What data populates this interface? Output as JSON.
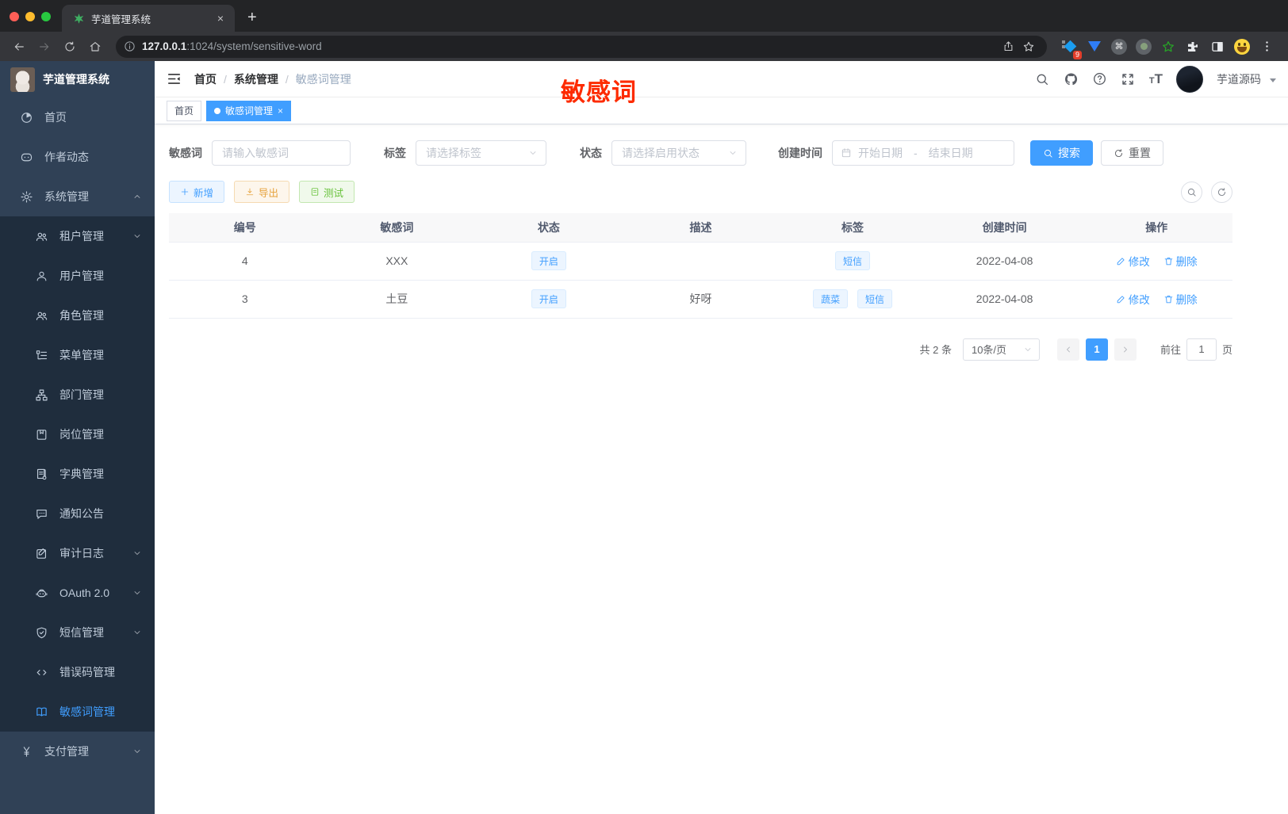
{
  "browser": {
    "tab_title": "芋道管理系统",
    "new_tab": "+",
    "close_tab": "×",
    "url": {
      "host": "127.0.0.1",
      "rest": ":1024/system/sensitive-word"
    },
    "extension_badge": "9",
    "cmd_glyph": "⌘"
  },
  "annotation": {
    "text": "敏感词",
    "color": "#fd2b01"
  },
  "sidebar": {
    "title": "芋道管理系统",
    "items": [
      {
        "icon": "dashboard-icon",
        "label": "首页"
      },
      {
        "icon": "chat-icon",
        "label": "作者动态"
      },
      {
        "icon": "gear-icon",
        "label": "系统管理",
        "expanded": true
      },
      {
        "icon": "tenant-icon",
        "label": "租户管理",
        "sub": true,
        "collapsible": true
      },
      {
        "icon": "user-icon",
        "label": "用户管理",
        "sub": true
      },
      {
        "icon": "role-icon",
        "label": "角色管理",
        "sub": true
      },
      {
        "icon": "menu-tree-icon",
        "label": "菜单管理",
        "sub": true
      },
      {
        "icon": "dept-icon",
        "label": "部门管理",
        "sub": true
      },
      {
        "icon": "post-icon",
        "label": "岗位管理",
        "sub": true
      },
      {
        "icon": "dict-icon",
        "label": "字典管理",
        "sub": true
      },
      {
        "icon": "notice-icon",
        "label": "通知公告",
        "sub": true
      },
      {
        "icon": "audit-icon",
        "label": "审计日志",
        "sub": true,
        "collapsible": true
      },
      {
        "icon": "oauth-icon",
        "label": "OAuth 2.0",
        "sub": true,
        "collapsible": true
      },
      {
        "icon": "sms-icon",
        "label": "短信管理",
        "sub": true,
        "collapsible": true
      },
      {
        "icon": "errcode-icon",
        "label": "错误码管理",
        "sub": true
      },
      {
        "icon": "sensitive-word-icon",
        "label": "敏感词管理",
        "sub": true,
        "active": true
      },
      {
        "icon": "pay-icon",
        "label": "支付管理",
        "collapsible": true
      }
    ]
  },
  "navbar": {
    "breadcrumb": [
      "首页",
      "系统管理",
      "敏感词管理"
    ],
    "separator": "/",
    "user": "芋道源码"
  },
  "tags_view": {
    "home": "首页",
    "active": "敏感词管理",
    "close": "×"
  },
  "filters": {
    "word": {
      "label": "敏感词",
      "placeholder": "请输入敏感词"
    },
    "tag": {
      "label": "标签",
      "placeholder": "请选择标签"
    },
    "status": {
      "label": "状态",
      "placeholder": "请选择启用状态"
    },
    "date": {
      "label": "创建时间",
      "start": "开始日期",
      "separator": "-",
      "end": "结束日期"
    },
    "search": "搜索",
    "reset": "重置"
  },
  "toolbar": {
    "add": "新增",
    "export": "导出",
    "test": "测试"
  },
  "table": {
    "columns": [
      "编号",
      "敏感词",
      "状态",
      "描述",
      "标签",
      "创建时间",
      "操作"
    ],
    "rows": [
      {
        "id": "4",
        "word": "XXX",
        "status": "开启",
        "desc": "",
        "tags": [
          "短信"
        ],
        "created": "2022-04-08"
      },
      {
        "id": "3",
        "word": "土豆",
        "status": "开启",
        "desc": "好呀",
        "tags": [
          "蔬菜",
          "短信"
        ],
        "created": "2022-04-08"
      }
    ],
    "actions": {
      "edit": "修改",
      "delete": "删除"
    }
  },
  "pagination": {
    "total": "共 2 条",
    "page_size": "10条/页",
    "page": "1",
    "goto_label": "前往",
    "goto_value": "1",
    "unit": "页"
  },
  "colors": {
    "accent": "#409eff",
    "sidebar_bg": "#304156",
    "submenu_bg": "#1f2d3d",
    "annotation_red": "#fd2b01"
  }
}
